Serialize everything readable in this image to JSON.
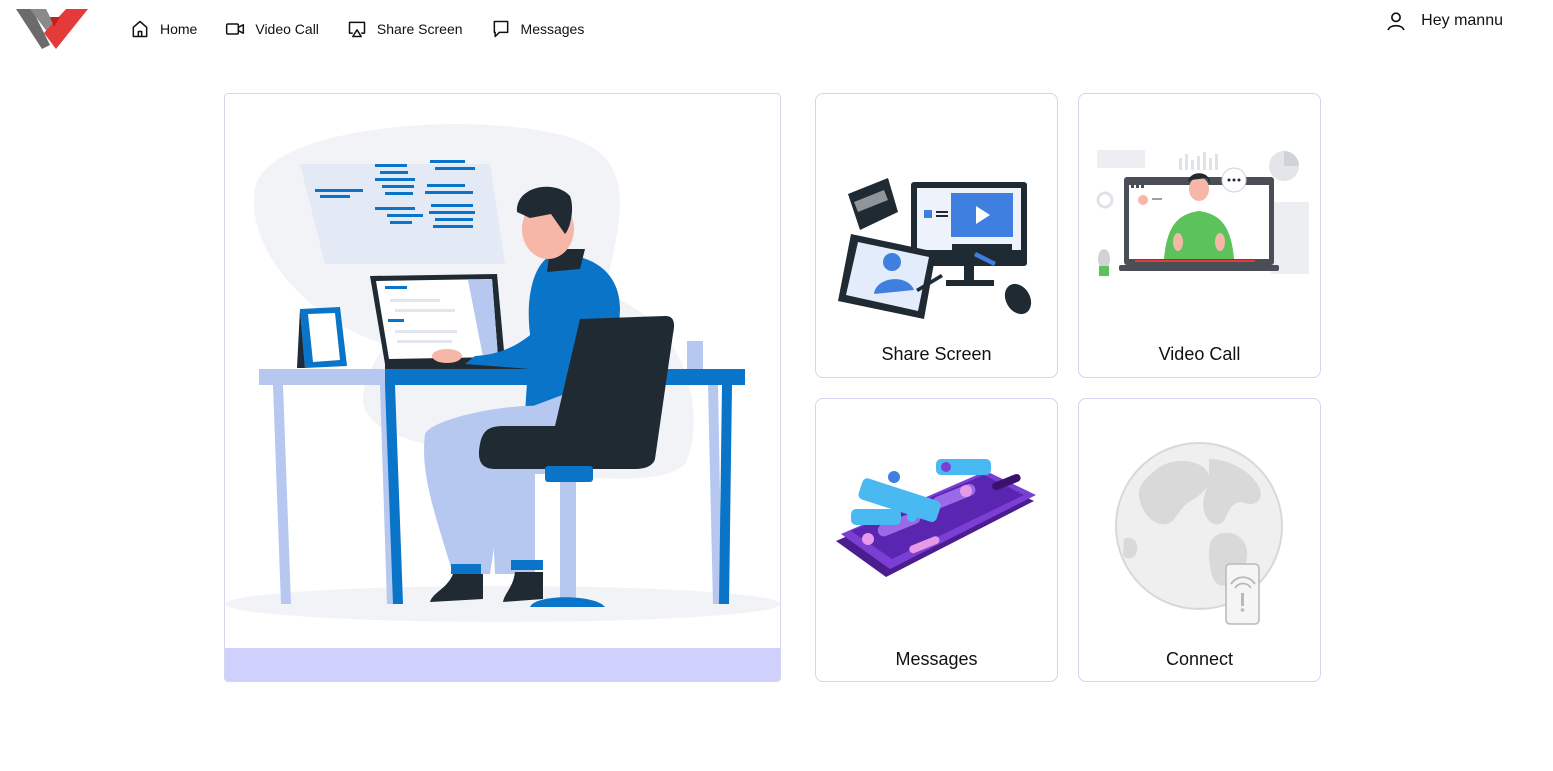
{
  "nav": {
    "items": [
      {
        "label": "Home",
        "icon": "home-icon"
      },
      {
        "label": "Video Call",
        "icon": "video-camera-icon"
      },
      {
        "label": "Share Screen",
        "icon": "cast-screen-icon"
      },
      {
        "label": "Messages",
        "icon": "message-bubble-icon"
      }
    ]
  },
  "user": {
    "greeting": "Hey mannu",
    "icon": "user-icon"
  },
  "cards": {
    "share": {
      "label": "Share Screen"
    },
    "video": {
      "label": "Video Call"
    },
    "messages": {
      "label": "Messages"
    },
    "connect": {
      "label": "Connect"
    }
  },
  "colors": {
    "brand_red": "#e43a3a",
    "brand_gray": "#6b6b6b",
    "accent_blue": "#0a74c9",
    "hero_bar": "#cfd0fb",
    "card_border": "#d3d3f2",
    "purple": "#6a2fb8"
  }
}
